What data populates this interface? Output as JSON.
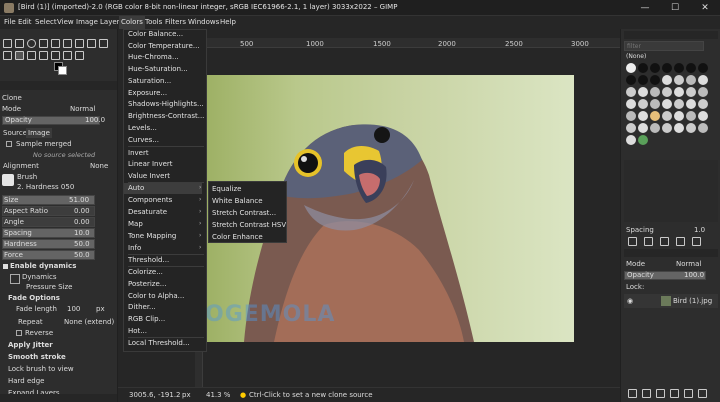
{
  "window": {
    "title": "[Bird (1)] (imported)-2.0 (RGB color 8-bit non-linear integer, sRGB IEC61966-2.1, 1 layer) 3033x2022 – GIMP",
    "minimize": "—",
    "maximize": "☐",
    "close": "✕"
  },
  "menubar": [
    "File",
    "Edit",
    "Select",
    "View",
    "Image",
    "Layer",
    "Colors",
    "Tools",
    "Filters",
    "Windows",
    "Help"
  ],
  "colors_menu": {
    "items": [
      "Color Balance...",
      "Color Temperature...",
      "Hue-Chroma...",
      "Hue-Saturation...",
      "Saturation...",
      "Exposure...",
      "Shadows-Highlights...",
      "Brightness-Contrast...",
      "Levels...",
      "Curves...",
      "Invert",
      "Linear Invert",
      "Value Invert",
      "Auto",
      "Components",
      "Desaturate",
      "Map",
      "Tone Mapping",
      "Info",
      "Threshold...",
      "Colorize...",
      "Posterize...",
      "Color to Alpha...",
      "Dither...",
      "RGB Clip...",
      "Hot...",
      "Local Threshold..."
    ],
    "submenu_arrow": "›"
  },
  "auto_submenu": [
    "Equalize",
    "White Balance",
    "Stretch Contrast...",
    "Stretch Contrast HSV",
    "Color Enhance"
  ],
  "ruler": {
    "top": [
      "500",
      "1000",
      "1500",
      "2000",
      "2500",
      "3000"
    ]
  },
  "tool_options": {
    "title": "Clone",
    "mode_label": "Mode",
    "mode_value": "Normal",
    "opacity_label": "Opacity",
    "opacity_value": "100.0",
    "source_label": "Source",
    "source_value": "Image",
    "sample_merged": "Sample merged",
    "no_source": "No source selected",
    "alignment_label": "Alignment",
    "alignment_value": "None",
    "brush_label": "Brush",
    "brush_value": "2. Hardness 050",
    "size_label": "Size",
    "size_value": "51.00",
    "aspect_label": "Aspect Ratio",
    "aspect_value": "0.00",
    "angle_label": "Angle",
    "angle_value": "0.00",
    "spacing_label": "Spacing",
    "spacing_value": "10.0",
    "hardness_label": "Hardness",
    "hardness_value": "50.0",
    "force_label": "Force",
    "force_value": "50.0",
    "enable_dynamics": "Enable dynamics",
    "dynamics_label": "Dynamics",
    "dynamics_value": "Pressure Size",
    "fade_options": "Fade Options",
    "fade_length_label": "Fade length",
    "fade_length_value": "100",
    "fade_unit": "px",
    "repeat_label": "Repeat",
    "repeat_value": "None (extend)",
    "reverse": "Reverse",
    "apply_jitter": "Apply Jitter",
    "smooth_stroke": "Smooth stroke",
    "lock_brush": "Lock brush to view",
    "hard_edge": "Hard edge",
    "expand_layers": "Expand Layers"
  },
  "statusbar": {
    "coords": "3005.6, -191.2",
    "unit": "px",
    "zoom": "41.3 %",
    "hint": "Ctrl-Click to set a new clone source"
  },
  "right_dock": {
    "filter_placeholder": "filter",
    "brush_name": "(None)",
    "spacing_label": "Spacing",
    "spacing_value": "1.0",
    "mode_label": "Mode",
    "mode_value": "Normal",
    "opacity_label": "Opacity",
    "opacity_value": "100.0",
    "lock_label": "Lock:",
    "layer_name": "Bird (1).jpg"
  },
  "watermark": "OGEMOLA",
  "colors": {
    "dark_bg": "#2b2b2b",
    "menu_bg": "#242424",
    "highlight": "#3d3d3d"
  }
}
